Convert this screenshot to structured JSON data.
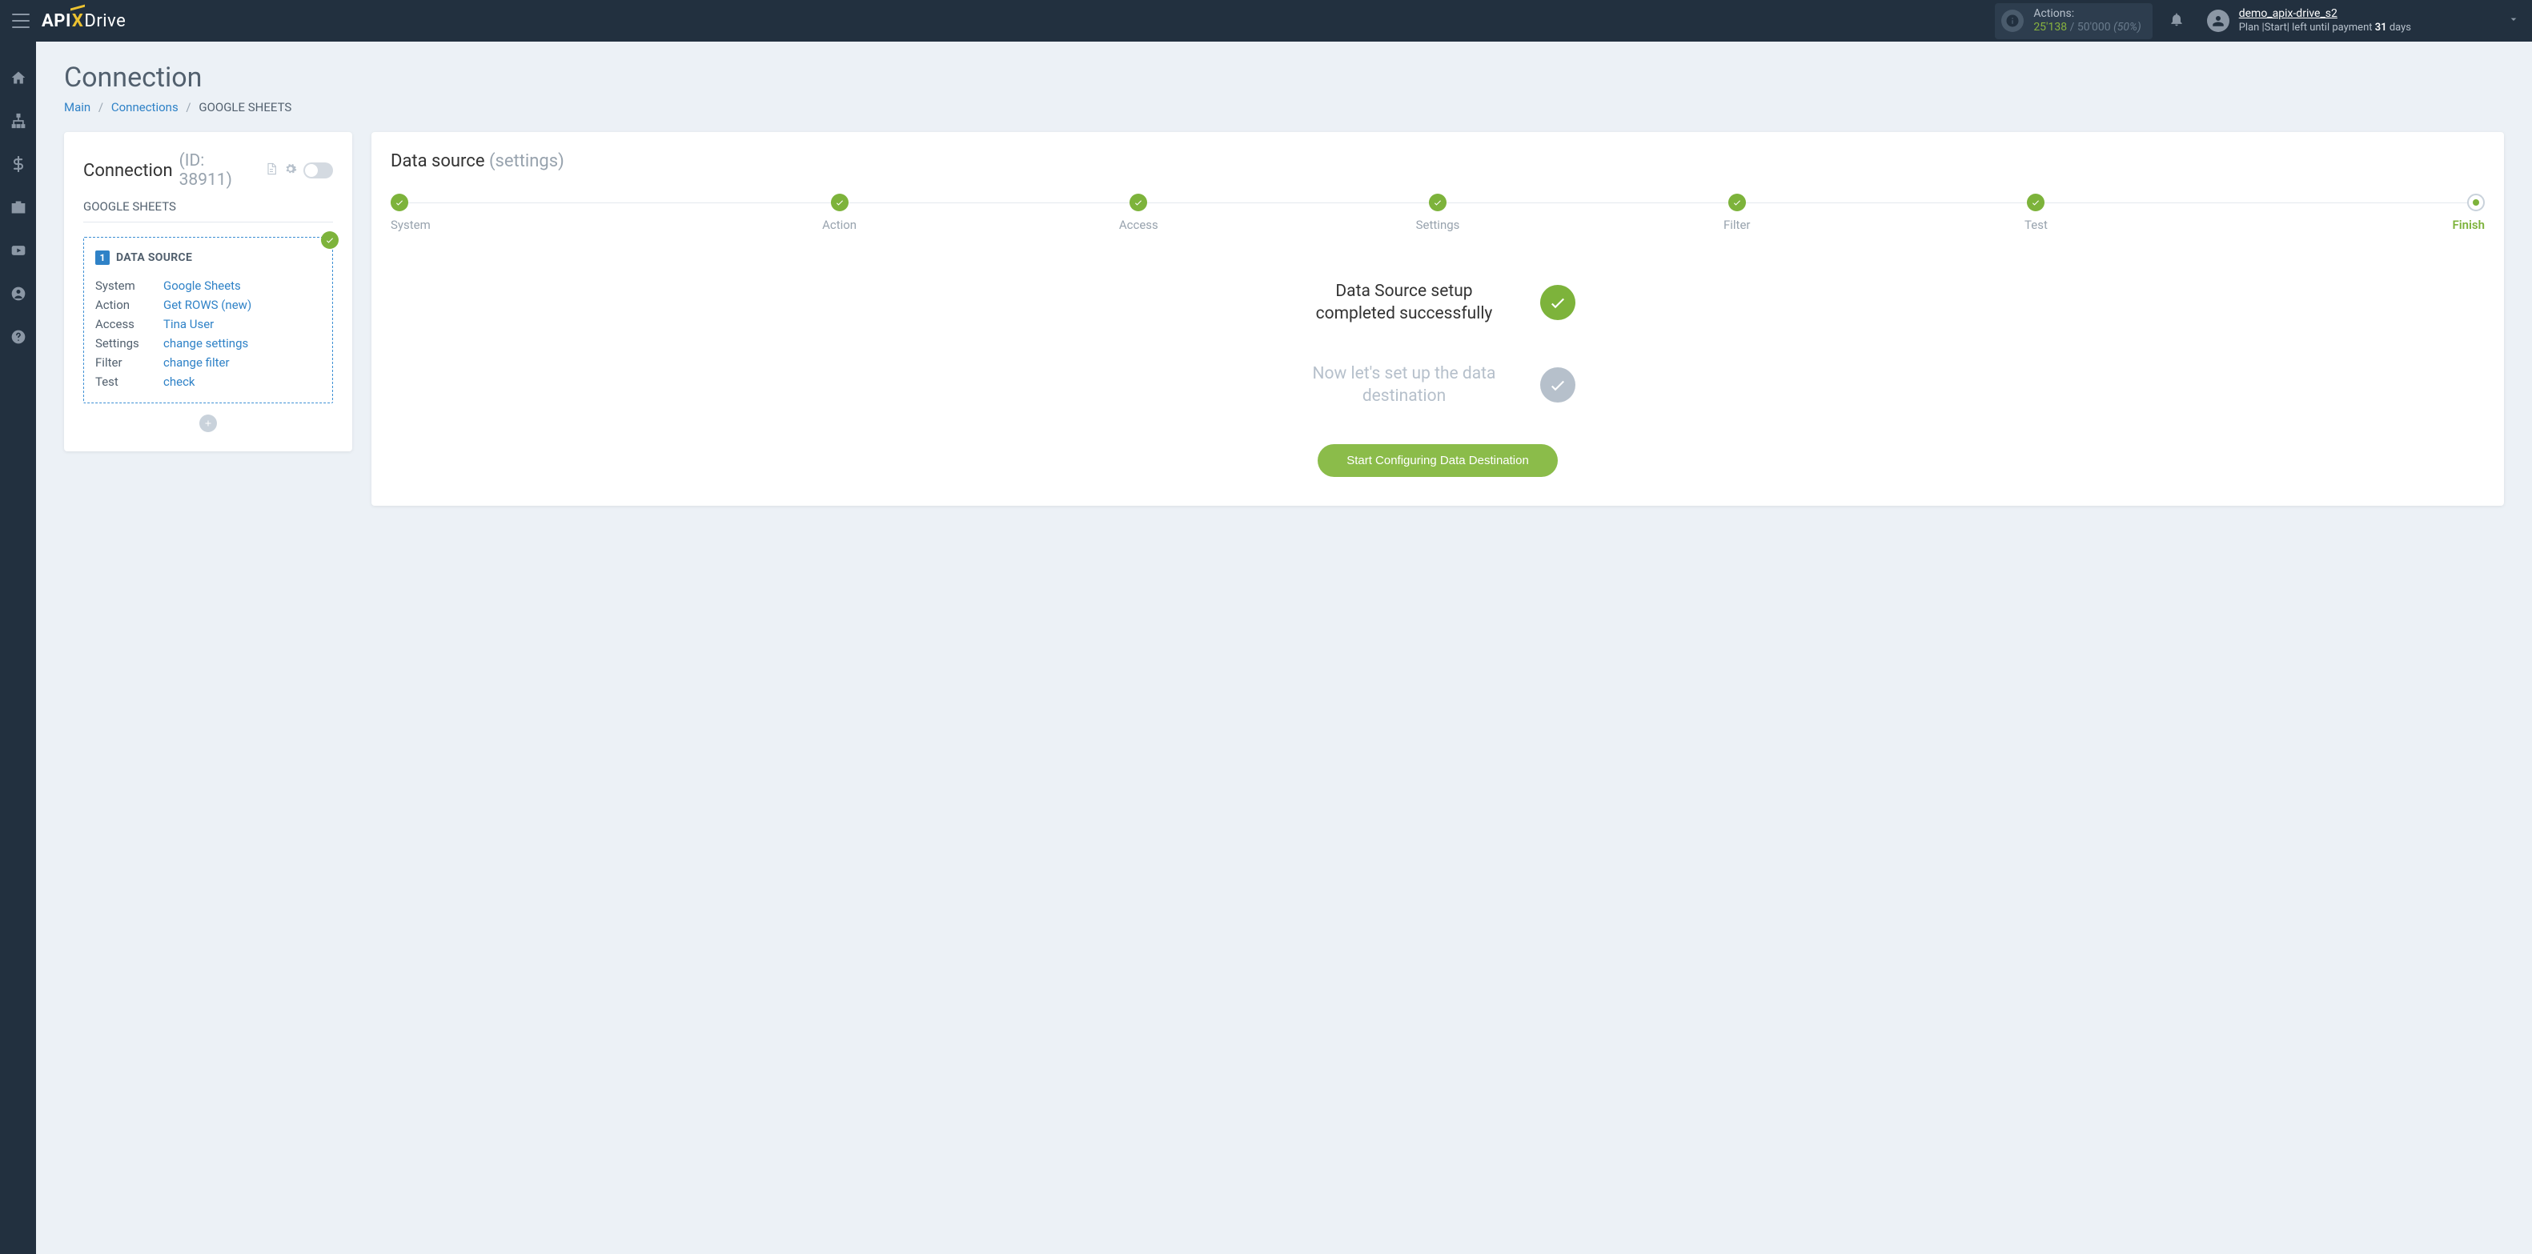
{
  "header": {
    "actions_label": "Actions:",
    "actions_used": "25'138",
    "actions_total": "50'000",
    "actions_pct": "(50%)",
    "username": "demo_apix-drive_s2",
    "plan_prefix": "Plan |Start| left until payment ",
    "plan_days": "31",
    "plan_suffix": " days"
  },
  "breadcrumb": {
    "main": "Main",
    "connections": "Connections",
    "current": "GOOGLE SHEETS"
  },
  "page_title": "Connection",
  "conn": {
    "title": "Connection",
    "id_label": "(ID: 38911)",
    "name": "GOOGLE SHEETS",
    "box_num": "1",
    "box_title": "DATA SOURCE",
    "rows": {
      "system_lbl": "System",
      "system_val": "Google Sheets",
      "action_lbl": "Action",
      "action_val": "Get ROWS (new)",
      "access_lbl": "Access",
      "access_val": "Tina User",
      "settings_lbl": "Settings",
      "settings_val": "change settings",
      "filter_lbl": "Filter",
      "filter_val": "change filter",
      "test_lbl": "Test",
      "test_val": "check"
    }
  },
  "right": {
    "title": "Data source",
    "subtitle": "(settings)",
    "steps": {
      "system": "System",
      "action": "Action",
      "access": "Access",
      "settings": "Settings",
      "filter": "Filter",
      "test": "Test",
      "finish": "Finish"
    },
    "success_msg": "Data Source setup completed successfully",
    "pending_msg": "Now let's set up the data destination",
    "cta": "Start Configuring Data Destination"
  }
}
